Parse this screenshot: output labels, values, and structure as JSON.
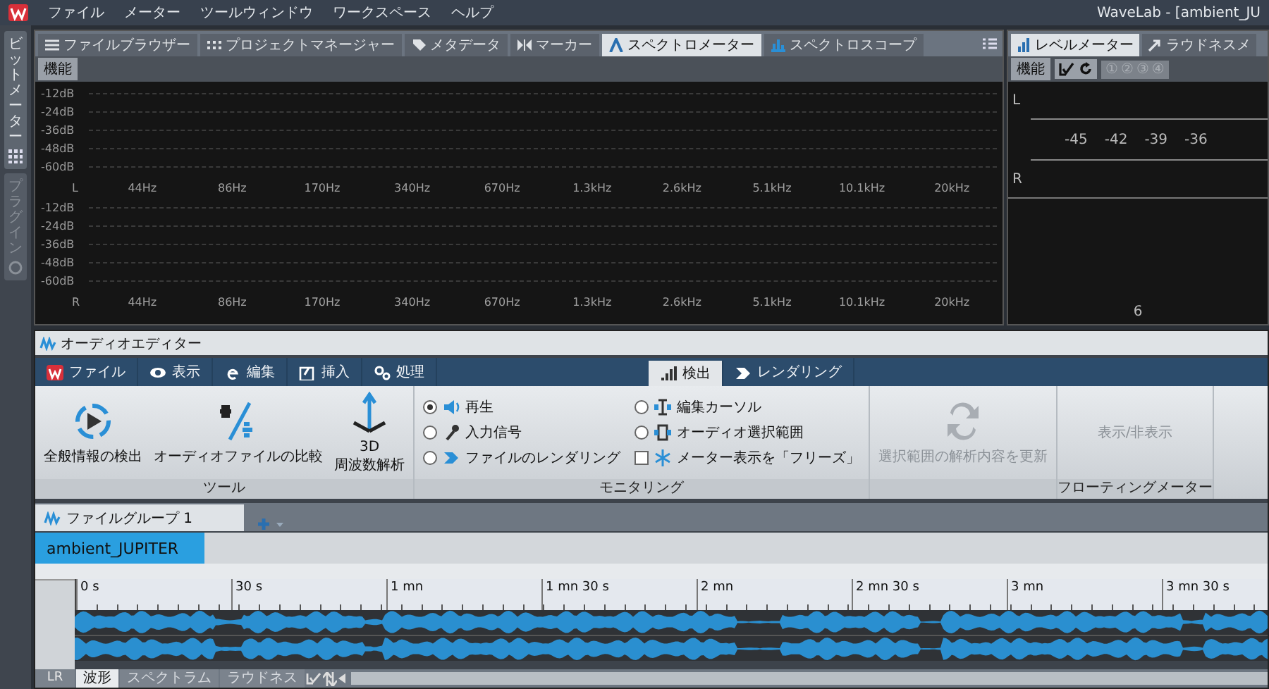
{
  "menubar": {
    "menus": [
      "ファイル",
      "メーター",
      "ツールウィンドウ",
      "ワークスペース",
      "ヘルプ"
    ],
    "title": "WaveLab - [ambient_JU"
  },
  "side_tabs": [
    {
      "label": "ビットメーター",
      "selected": true
    },
    {
      "label": "プラグイン",
      "selected": false
    }
  ],
  "spectrometer": {
    "tabs": [
      {
        "label": "ファイルブラウザー",
        "selected": false
      },
      {
        "label": "プロジェクトマネージャー",
        "selected": false
      },
      {
        "label": "メタデータ",
        "selected": false
      },
      {
        "label": "マーカー",
        "selected": false
      },
      {
        "label": "スペクトロメーター",
        "selected": true
      },
      {
        "label": "スペクトロスコープ",
        "selected": false
      }
    ],
    "toolbar_button": "機能",
    "channels": [
      {
        "label": "L",
        "db_labels": [
          "-12dB",
          "-24dB",
          "-36dB",
          "-48dB",
          "-60dB"
        ],
        "freq_labels": [
          "44Hz",
          "86Hz",
          "170Hz",
          "340Hz",
          "670Hz",
          "1.3kHz",
          "2.6kHz",
          "5.1kHz",
          "10.1kHz",
          "20kHz"
        ]
      },
      {
        "label": "R",
        "db_labels": [
          "-12dB",
          "-24dB",
          "-36dB",
          "-48dB",
          "-60dB"
        ],
        "freq_labels": [
          "44Hz",
          "86Hz",
          "170Hz",
          "340Hz",
          "670Hz",
          "1.3kHz",
          "2.6kHz",
          "5.1kHz",
          "10.1kHz",
          "20kHz"
        ]
      }
    ]
  },
  "level_meter": {
    "tabs": [
      {
        "label": "レベルメーター",
        "selected": true
      },
      {
        "label": "ラウドネスメ",
        "selected": false
      }
    ],
    "toolbar_button": "機能",
    "presets": [
      {
        "label": "①",
        "disabled": true
      },
      {
        "label": "②",
        "disabled": true
      },
      {
        "label": "③",
        "disabled": true
      },
      {
        "label": "④",
        "disabled": true
      }
    ],
    "channels": [
      "L",
      "R"
    ],
    "scale": [
      "-45",
      "-42",
      "-39",
      "-36"
    ],
    "footer": "6"
  },
  "audio_editor": {
    "title": "オーディオエディター",
    "tabs": [
      {
        "label": "ファイル",
        "selected": false
      },
      {
        "label": "表示",
        "selected": false
      },
      {
        "label": "編集",
        "selected": false
      },
      {
        "label": "挿入",
        "selected": false
      },
      {
        "label": "処理",
        "selected": false
      },
      {
        "label": "検出",
        "selected": true
      },
      {
        "label": "レンダリング",
        "selected": false
      }
    ],
    "groups": [
      {
        "caption": "ツール",
        "items": [
          {
            "kind": "big",
            "label": "全般情報の検出",
            "disabled": false
          },
          {
            "kind": "big",
            "label": "オーディオファイルの比較",
            "disabled": false
          },
          {
            "kind": "big",
            "label": "3D\n周波数解析",
            "disabled": false
          }
        ]
      },
      {
        "caption": "モニタリング",
        "items": [
          {
            "kind": "radio",
            "label": "再生",
            "selected": true
          },
          {
            "kind": "radio",
            "label": "入力信号",
            "selected": false
          },
          {
            "kind": "radio",
            "label": "ファイルのレンダリング",
            "selected": false
          },
          {
            "kind": "radio",
            "label": "編集カーソル",
            "selected": false
          },
          {
            "kind": "radio",
            "label": "オーディオ選択範囲",
            "selected": false
          },
          {
            "kind": "check",
            "label": "メーター表示を「フリーズ」",
            "checked": false
          }
        ]
      },
      {
        "items": [
          {
            "kind": "big",
            "label": "選択範囲の解析内容を更新",
            "disabled": true
          }
        ]
      },
      {
        "caption": "フローティングメーター",
        "items": [
          {
            "kind": "text",
            "label": "表示/非表示",
            "disabled": true
          }
        ]
      }
    ],
    "file_groups": [
      {
        "label": "ファイルグループ 1",
        "selected": true
      }
    ],
    "files": [
      {
        "label": "ambient_JUPITER",
        "selected": true
      }
    ],
    "ruler": [
      "0 s",
      "30 s",
      "1 mn",
      "1 mn 30 s",
      "2 mn",
      "2 mn 30 s",
      "3 mn",
      "3 mn 30 s"
    ],
    "channel_label": "LR",
    "view_tabs": [
      {
        "label": "波形",
        "selected": true
      },
      {
        "label": "スペクトラム",
        "selected": false
      },
      {
        "label": "ラウドネス",
        "selected": false
      }
    ]
  }
}
